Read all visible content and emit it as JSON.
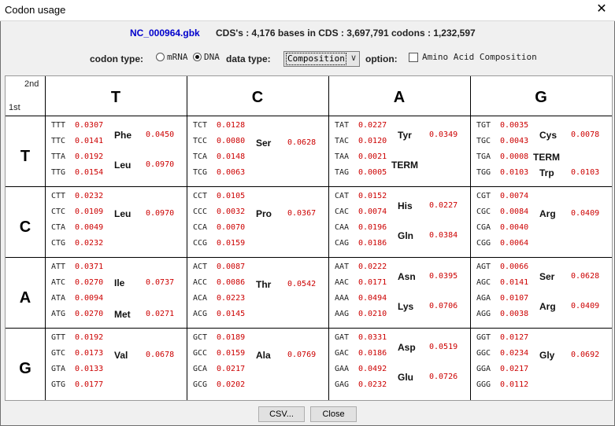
{
  "window": {
    "title": "Codon usage",
    "close_glyph": "✕"
  },
  "info": {
    "file": "NC_000964.gbk",
    "stats": "CDS's : 4,176  bases in CDS : 3,697,791  codons : 1,232,597"
  },
  "options": {
    "codon_type_label": "codon type:",
    "radio_mrna": "mRNA",
    "radio_dna": "DNA",
    "selected_codon_type": "DNA",
    "data_type_label": "data type:",
    "data_type_value": "Composition...",
    "option_label": "option:",
    "amino_acid_label": "Amino Acid Composition",
    "amino_acid_checked": false
  },
  "table": {
    "corner_second": "2nd",
    "corner_first": "1st",
    "columns": [
      "T",
      "C",
      "A",
      "G"
    ],
    "rows": [
      "T",
      "C",
      "A",
      "G"
    ],
    "blocks": [
      [
        {
          "codons": [
            [
              "TTT",
              "0.0307"
            ],
            [
              "TTC",
              "0.0141"
            ],
            [
              "TTA",
              "0.0192"
            ],
            [
              "TTG",
              "0.0154"
            ]
          ],
          "aas": [
            {
              "name": "Phe",
              "value": "0.0450",
              "pos": "upper"
            },
            {
              "name": "Leu",
              "value": "0.0970",
              "pos": "lower"
            }
          ]
        },
        {
          "codons": [
            [
              "TCT",
              "0.0128"
            ],
            [
              "TCC",
              "0.0080"
            ],
            [
              "TCA",
              "0.0148"
            ],
            [
              "TCG",
              "0.0063"
            ]
          ],
          "aas": [
            {
              "name": "Ser",
              "value": "0.0628",
              "pos": "full"
            }
          ]
        },
        {
          "codons": [
            [
              "TAT",
              "0.0227"
            ],
            [
              "TAC",
              "0.0120"
            ],
            [
              "TAA",
              "0.0021"
            ],
            [
              "TAG",
              "0.0005"
            ]
          ],
          "aas": [
            {
              "name": "Tyr",
              "value": "0.0349",
              "pos": "upper"
            },
            {
              "name": "TERM",
              "value": "",
              "pos": "lower"
            }
          ]
        },
        {
          "codons": [
            [
              "TGT",
              "0.0035"
            ],
            [
              "TGC",
              "0.0043"
            ],
            [
              "TGA",
              "0.0008"
            ],
            [
              "TGG",
              "0.0103"
            ]
          ],
          "aas": [
            {
              "name": "Cys",
              "value": "0.0078",
              "pos": "upper"
            },
            {
              "name": "TERM",
              "value": "",
              "pos": "row3"
            },
            {
              "name": "Trp",
              "value": "0.0103",
              "pos": "row4"
            }
          ]
        }
      ],
      [
        {
          "codons": [
            [
              "CTT",
              "0.0232"
            ],
            [
              "CTC",
              "0.0109"
            ],
            [
              "CTA",
              "0.0049"
            ],
            [
              "CTG",
              "0.0232"
            ]
          ],
          "aas": [
            {
              "name": "Leu",
              "value": "0.0970",
              "pos": "full"
            }
          ]
        },
        {
          "codons": [
            [
              "CCT",
              "0.0105"
            ],
            [
              "CCC",
              "0.0032"
            ],
            [
              "CCA",
              "0.0070"
            ],
            [
              "CCG",
              "0.0159"
            ]
          ],
          "aas": [
            {
              "name": "Pro",
              "value": "0.0367",
              "pos": "full"
            }
          ]
        },
        {
          "codons": [
            [
              "CAT",
              "0.0152"
            ],
            [
              "CAC",
              "0.0074"
            ],
            [
              "CAA",
              "0.0196"
            ],
            [
              "CAG",
              "0.0186"
            ]
          ],
          "aas": [
            {
              "name": "His",
              "value": "0.0227",
              "pos": "upper"
            },
            {
              "name": "Gln",
              "value": "0.0384",
              "pos": "lower"
            }
          ]
        },
        {
          "codons": [
            [
              "CGT",
              "0.0074"
            ],
            [
              "CGC",
              "0.0084"
            ],
            [
              "CGA",
              "0.0040"
            ],
            [
              "CGG",
              "0.0064"
            ]
          ],
          "aas": [
            {
              "name": "Arg",
              "value": "0.0409",
              "pos": "full"
            }
          ]
        }
      ],
      [
        {
          "codons": [
            [
              "ATT",
              "0.0371"
            ],
            [
              "ATC",
              "0.0270"
            ],
            [
              "ATA",
              "0.0094"
            ],
            [
              "ATG",
              "0.0270"
            ]
          ],
          "aas": [
            {
              "name": "Ile",
              "value": "0.0737",
              "pos": "upper3"
            },
            {
              "name": "Met",
              "value": "0.0271",
              "pos": "row4"
            }
          ]
        },
        {
          "codons": [
            [
              "ACT",
              "0.0087"
            ],
            [
              "ACC",
              "0.0086"
            ],
            [
              "ACA",
              "0.0223"
            ],
            [
              "ACG",
              "0.0145"
            ]
          ],
          "aas": [
            {
              "name": "Thr",
              "value": "0.0542",
              "pos": "full"
            }
          ]
        },
        {
          "codons": [
            [
              "AAT",
              "0.0222"
            ],
            [
              "AAC",
              "0.0171"
            ],
            [
              "AAA",
              "0.0494"
            ],
            [
              "AAG",
              "0.0210"
            ]
          ],
          "aas": [
            {
              "name": "Asn",
              "value": "0.0395",
              "pos": "upper"
            },
            {
              "name": "Lys",
              "value": "0.0706",
              "pos": "lower"
            }
          ]
        },
        {
          "codons": [
            [
              "AGT",
              "0.0066"
            ],
            [
              "AGC",
              "0.0141"
            ],
            [
              "AGA",
              "0.0107"
            ],
            [
              "AGG",
              "0.0038"
            ]
          ],
          "aas": [
            {
              "name": "Ser",
              "value": "0.0628",
              "pos": "upper"
            },
            {
              "name": "Arg",
              "value": "0.0409",
              "pos": "lower"
            }
          ]
        }
      ],
      [
        {
          "codons": [
            [
              "GTT",
              "0.0192"
            ],
            [
              "GTC",
              "0.0173"
            ],
            [
              "GTA",
              "0.0133"
            ],
            [
              "GTG",
              "0.0177"
            ]
          ],
          "aas": [
            {
              "name": "Val",
              "value": "0.0678",
              "pos": "full"
            }
          ]
        },
        {
          "codons": [
            [
              "GCT",
              "0.0189"
            ],
            [
              "GCC",
              "0.0159"
            ],
            [
              "GCA",
              "0.0217"
            ],
            [
              "GCG",
              "0.0202"
            ]
          ],
          "aas": [
            {
              "name": "Ala",
              "value": "0.0769",
              "pos": "full"
            }
          ]
        },
        {
          "codons": [
            [
              "GAT",
              "0.0331"
            ],
            [
              "GAC",
              "0.0186"
            ],
            [
              "GAA",
              "0.0492"
            ],
            [
              "GAG",
              "0.0232"
            ]
          ],
          "aas": [
            {
              "name": "Asp",
              "value": "0.0519",
              "pos": "upper"
            },
            {
              "name": "Glu",
              "value": "0.0726",
              "pos": "lower"
            }
          ]
        },
        {
          "codons": [
            [
              "GGT",
              "0.0127"
            ],
            [
              "GGC",
              "0.0234"
            ],
            [
              "GGA",
              "0.0217"
            ],
            [
              "GGG",
              "0.0112"
            ]
          ],
          "aas": [
            {
              "name": "Gly",
              "value": "0.0692",
              "pos": "full"
            }
          ]
        }
      ]
    ]
  },
  "buttons": {
    "csv": "CSV...",
    "close": "Close"
  }
}
